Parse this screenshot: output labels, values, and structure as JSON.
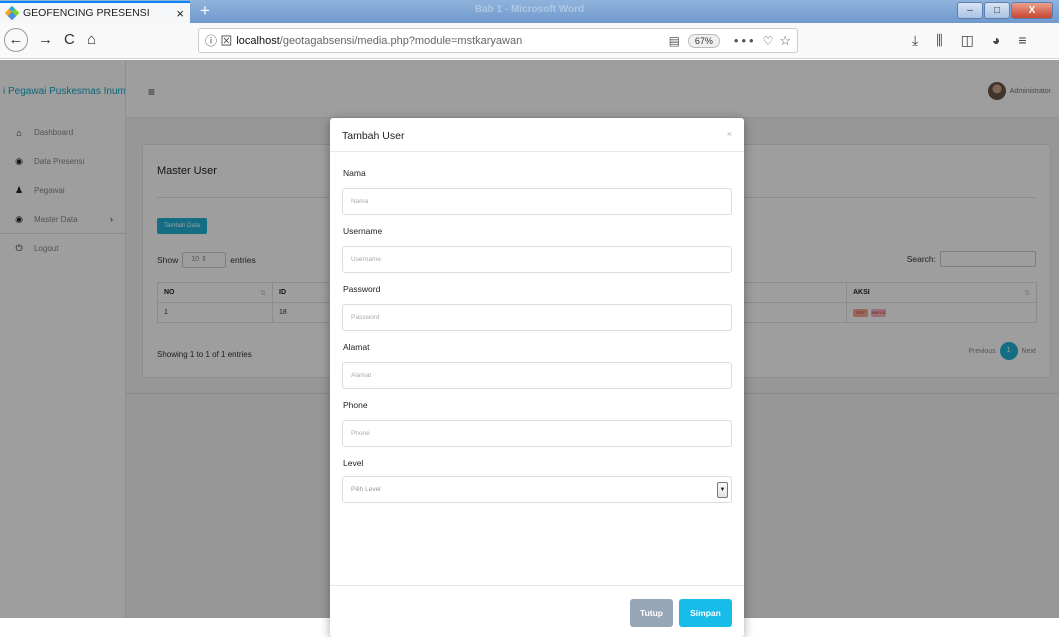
{
  "browser": {
    "tab_title": "GEOFENCING PRESENSI",
    "tab_close": "×",
    "new_tab": "+",
    "window_title": "Bab 1 - Microsoft Word",
    "url_prefix": "localhost",
    "url_path": "/geotagabsensi/media.php?module=mstkaryawan",
    "zoom": "67%",
    "more": "•••",
    "nav": {
      "back": "←",
      "forward": "→",
      "reload": "C",
      "home": "⌂"
    },
    "favicon_colors": [
      "#28a9e0",
      "#f5a623",
      "#7ed321",
      "#4a90e2"
    ]
  },
  "sidebar": {
    "brand": "i Pegawai Puskesmas Inum",
    "items": [
      {
        "label": "Dashboard",
        "icon": "home-icon",
        "glyph": "⌂"
      },
      {
        "label": "Data Presensi",
        "icon": "dot-circle-icon",
        "glyph": "◉"
      },
      {
        "label": "Pegawai",
        "icon": "user-icon",
        "glyph": "♟"
      },
      {
        "label": "Master Data",
        "icon": "dot-circle-icon",
        "glyph": "◉",
        "chevron": "›"
      },
      {
        "label": "Logout",
        "icon": "power-icon",
        "glyph": "⏻"
      }
    ]
  },
  "topbar": {
    "hamburger": "≡",
    "user": "Administrator"
  },
  "card": {
    "title": "Master User",
    "add_button": "Tambah Data",
    "show_prefix": "Show",
    "show_value": "10",
    "show_suffix": "entries",
    "search_label": "Search:",
    "columns": {
      "no": "NO",
      "id": "ID",
      "aksi": "AKSI"
    },
    "rows": [
      {
        "no": "1",
        "id": "18",
        "edit": "EDIT",
        "hapus": "HAPUS"
      }
    ],
    "showing": "Showing 1 to 1 of 1 entries",
    "pagination": {
      "previous": "Previous",
      "current": "1",
      "next": "Next"
    }
  },
  "modal": {
    "title": "Tambah User",
    "close": "×",
    "fields": [
      {
        "label": "Nama",
        "placeholder": "Nama"
      },
      {
        "label": "Username",
        "placeholder": "Username"
      },
      {
        "label": "Password",
        "placeholder": "Password"
      },
      {
        "label": "Alamat",
        "placeholder": "Alamat"
      },
      {
        "label": "Phone",
        "placeholder": "Phone"
      }
    ],
    "level": {
      "label": "Level",
      "selected": "Pilih Level"
    },
    "buttons": {
      "tutup": "Tutup",
      "simpan": "Simpan"
    }
  },
  "colors": {
    "accent": "#1fb2d3",
    "simpan": "#18bce8",
    "tutup": "#97a6b6",
    "brand_text": "#11a8c7"
  }
}
